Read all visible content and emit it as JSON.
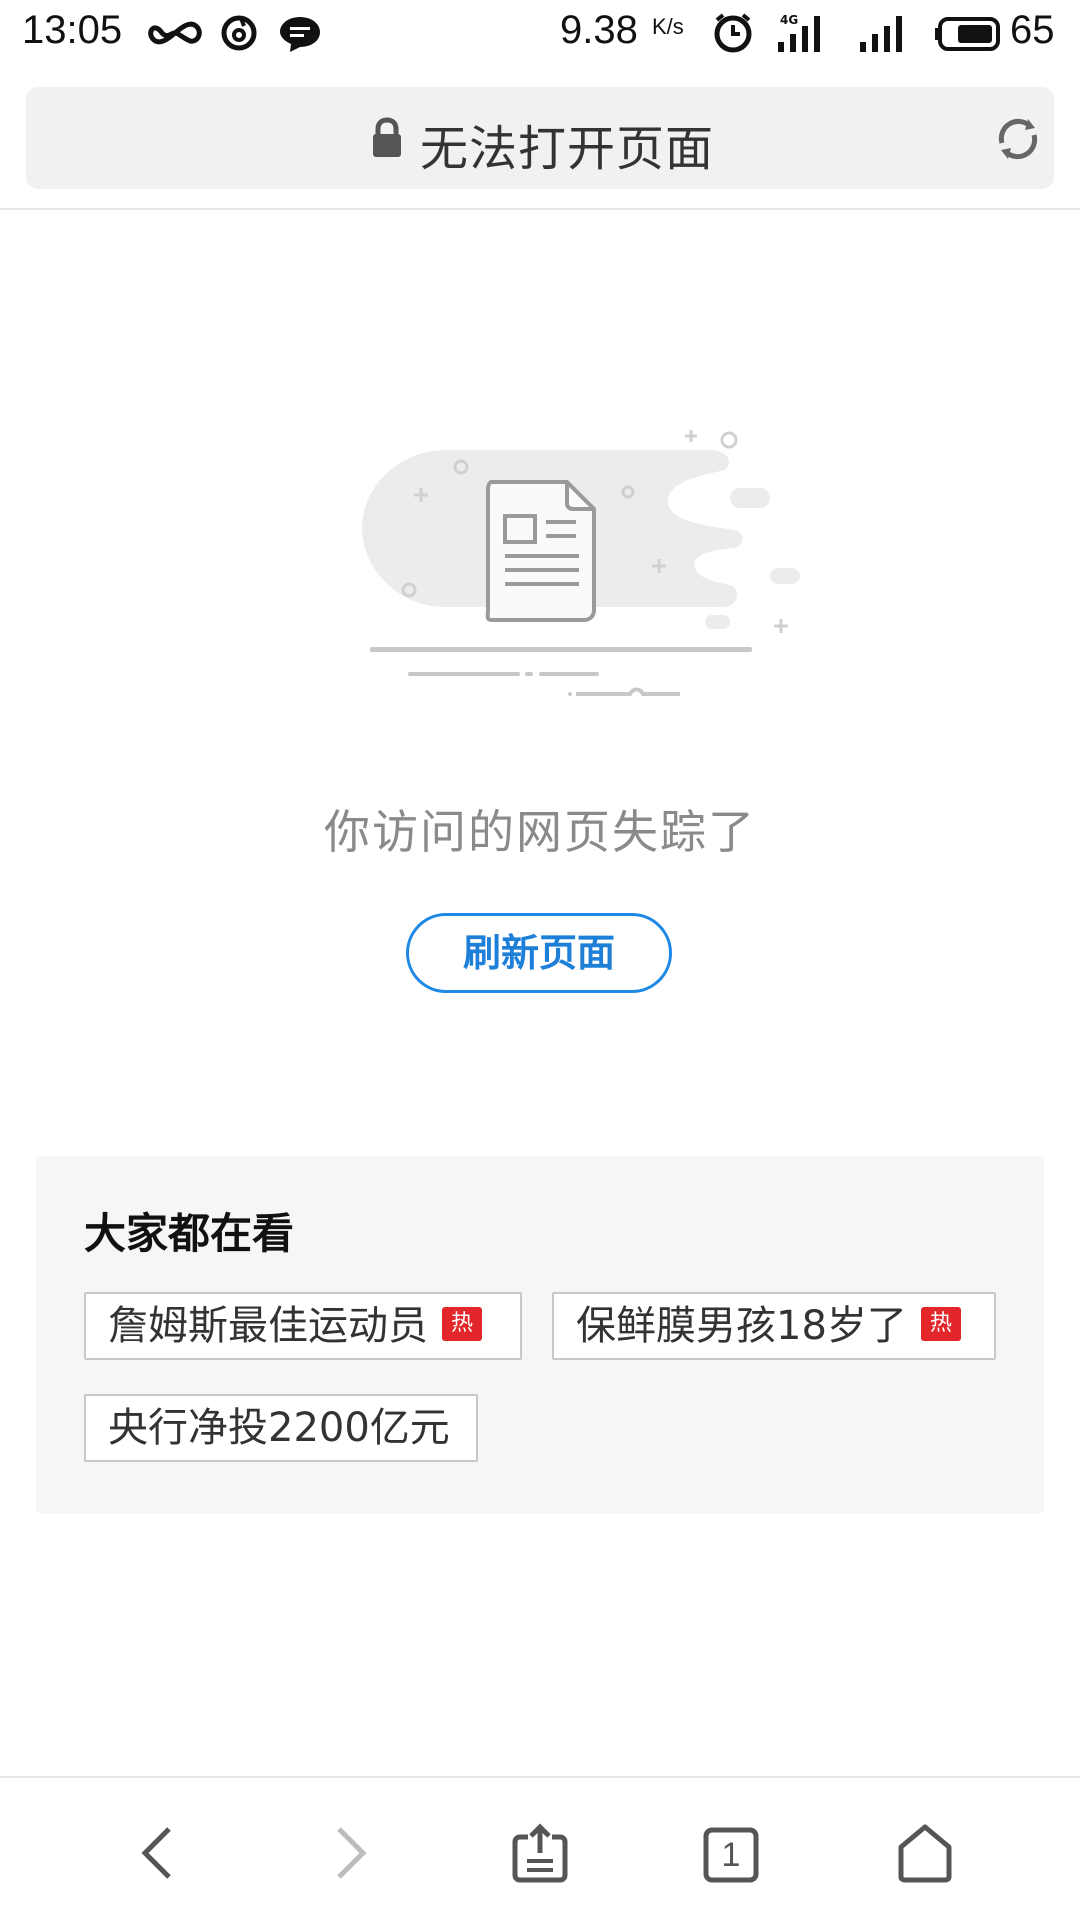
{
  "status_bar": {
    "time": "13:05",
    "speed": "9.38",
    "speed_unit": "K/s",
    "battery_percent": "65",
    "icons": [
      "infinity-icon",
      "netease-music-icon",
      "chat-bubble-icon",
      "alarm-icon",
      "4g-signal-icon",
      "signal-icon",
      "battery-icon"
    ]
  },
  "address_bar": {
    "title": "无法打开页面",
    "lock_icon": "lock-icon",
    "reload_icon": "reload-icon"
  },
  "error": {
    "message": "你访问的网页失踪了",
    "refresh_label": "刷新页面"
  },
  "trending": {
    "title": "大家都在看",
    "hot_badge": "热",
    "tags": [
      {
        "text": "詹姆斯最佳运动员",
        "hot": true
      },
      {
        "text": "保鲜膜男孩18岁了",
        "hot": true
      },
      {
        "text": "央行净投2200亿元",
        "hot": false
      }
    ]
  },
  "toolbar": {
    "tab_count": "1",
    "icons": [
      "back-icon",
      "forward-icon",
      "share-icon",
      "tabs-icon",
      "home-icon"
    ]
  },
  "colors": {
    "accent": "#1e88e5",
    "hot": "#e3262a",
    "panel_bg": "#f5f6f8"
  }
}
